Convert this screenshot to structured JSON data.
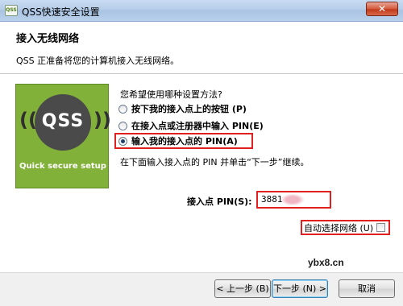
{
  "window": {
    "title": "QSS快速安全设置",
    "app_icon_text": "QSS",
    "close_symbol": "✕"
  },
  "header": {
    "title": "接入无线网络",
    "subtitle": "QSS 正准备将您的计算机接入无线网络。"
  },
  "logo": {
    "arc_left": "((",
    "arc_right": "))",
    "text": "QSS",
    "caption": "Quick secure setup"
  },
  "setup": {
    "question": "您希望使用哪种设置方法?",
    "options": [
      {
        "label": "按下我的接入点上的按钮 (P)",
        "checked": false
      },
      {
        "label": "在接入点或注册器中输入 PIN(E)",
        "checked": false
      },
      {
        "label": "输入我的接入点的 PIN(A)",
        "checked": true
      }
    ],
    "hint": "在下面输入接入点的 PIN 并单击“下一步”继续。"
  },
  "pin": {
    "label": "接入点 PIN(S):",
    "value": "3881"
  },
  "auto_select": {
    "label": "自动选择网络 (U)",
    "checked": false
  },
  "watermark": "ybx8.cn",
  "footer": {
    "back_label": "< 上一步 (B)",
    "next_label": "下一步 (N) >",
    "cancel_label": "取消"
  },
  "colors": {
    "highlight": "#e02020",
    "logo_green": "#82b13a"
  }
}
